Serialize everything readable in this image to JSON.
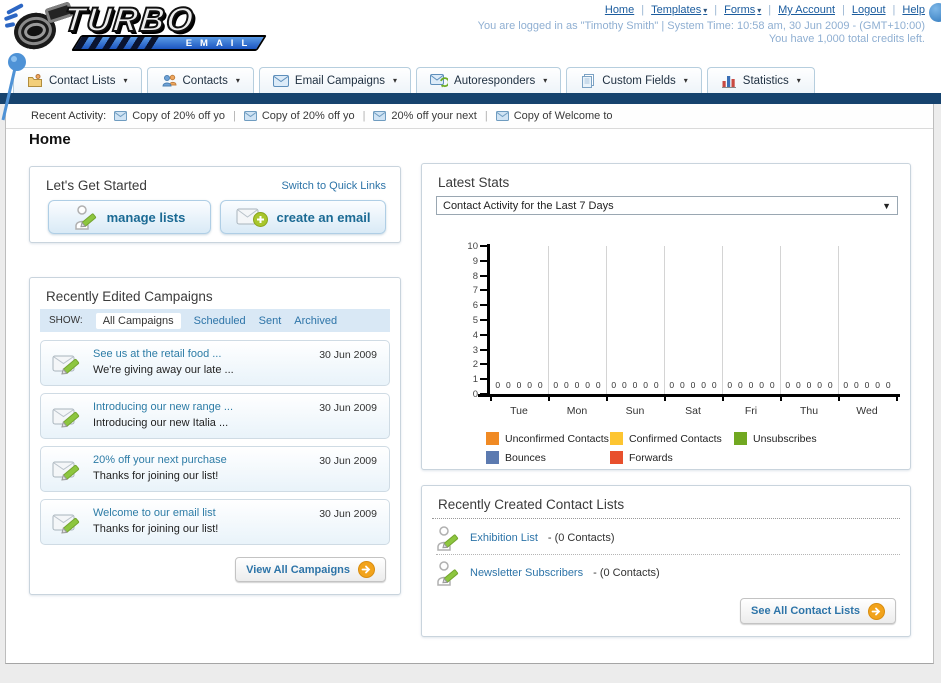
{
  "colors": {
    "navy_bar": "#16436e",
    "link_blue": "#1b5c9e",
    "accent_green": "#8dc63f",
    "accent_orange": "#f2a31b",
    "login_text": "#8fafd2",
    "filter_bar_bg": "#d9e8f5"
  },
  "header": {
    "logo": {
      "title": "TURBO",
      "subtitle": "EMAIL"
    },
    "nav_links": [
      {
        "label": "Home",
        "has_dropdown": false
      },
      {
        "label": "Templates",
        "has_dropdown": true
      },
      {
        "label": "Forms",
        "has_dropdown": true
      },
      {
        "label": "My Account",
        "has_dropdown": false
      },
      {
        "label": "Logout",
        "has_dropdown": false
      },
      {
        "label": "Help",
        "has_dropdown": false
      }
    ],
    "login_line1": "You are logged in as \"Timothy Smith\" | System Time: 10:58 am, 30 Jun 2009 - (GMT+10:00)",
    "login_line2": "You have 1,000 total credits left."
  },
  "tabs": [
    {
      "label": "Contact Lists",
      "icon": "contact-lists"
    },
    {
      "label": "Contacts",
      "icon": "contacts"
    },
    {
      "label": "Email Campaigns",
      "icon": "email-campaigns"
    },
    {
      "label": "Autoresponders",
      "icon": "autoresponders"
    },
    {
      "label": "Custom Fields",
      "icon": "custom-fields"
    },
    {
      "label": "Statistics",
      "icon": "statistics"
    }
  ],
  "recent_activity": {
    "label": "Recent Activity:",
    "items": [
      "Copy of 20% off yo",
      "Copy of 20% off yo",
      "20% off your next",
      "Copy of Welcome to"
    ]
  },
  "page_title": "Home",
  "get_started": {
    "title": "Let's Get Started",
    "switch_link": "Switch to Quick Links",
    "manage_lists_label": "manage lists",
    "create_email_label": "create an email"
  },
  "campaigns": {
    "title": "Recently Edited Campaigns",
    "show_label": "SHOW:",
    "filters": [
      "All Campaigns",
      "Scheduled",
      "Sent",
      "Archived"
    ],
    "active_filter": "All Campaigns",
    "items": [
      {
        "title": "See us at the retail food ...",
        "subtitle": "We're giving away our late ...",
        "date": "30 Jun 2009"
      },
      {
        "title": "Introducing our new range ...",
        "subtitle": "Introducing our new Italia ...",
        "date": "30 Jun 2009"
      },
      {
        "title": "20% off your next purchase",
        "subtitle": "Thanks for joining our list!",
        "date": "30 Jun 2009"
      },
      {
        "title": "Welcome to our email list",
        "subtitle": "Thanks for joining our list!",
        "date": "30 Jun 2009"
      }
    ],
    "view_all_label": "View All Campaigns"
  },
  "latest_stats": {
    "title": "Latest Stats",
    "period_selected": "Contact Activity for the Last 7 Days"
  },
  "chart_data": {
    "type": "bar",
    "title": "Contact Activity for the Last 7 Days",
    "categories": [
      "Tue",
      "Mon",
      "Sun",
      "Sat",
      "Fri",
      "Thu",
      "Wed"
    ],
    "series": [
      {
        "name": "Unconfirmed Contacts",
        "color": "#f08a24",
        "values": [
          0,
          0,
          0,
          0,
          0,
          0,
          0
        ]
      },
      {
        "name": "Confirmed Contacts",
        "color": "#fdc531",
        "values": [
          0,
          0,
          0,
          0,
          0,
          0,
          0
        ]
      },
      {
        "name": "Unsubscribes",
        "color": "#71a821",
        "values": [
          0,
          0,
          0,
          0,
          0,
          0,
          0
        ]
      },
      {
        "name": "Bounces",
        "color": "#5c7ab0",
        "values": [
          0,
          0,
          0,
          0,
          0,
          0,
          0
        ]
      },
      {
        "name": "Forwards",
        "color": "#e8502d",
        "values": [
          0,
          0,
          0,
          0,
          0,
          0,
          0
        ]
      }
    ],
    "ylim": [
      0,
      10
    ],
    "yticks": [
      0,
      1,
      2,
      3,
      4,
      5,
      6,
      7,
      8,
      9,
      10
    ],
    "show_value_labels": true,
    "grid": "vertical-only",
    "legend_position": "bottom"
  },
  "contact_lists_panel": {
    "title": "Recently Created Contact Lists",
    "items": [
      {
        "name": "Exhibition List",
        "detail": "- (0 Contacts)"
      },
      {
        "name": "Newsletter Subscribers",
        "detail": "- (0 Contacts)"
      }
    ],
    "see_all_label": "See All Contact Lists"
  }
}
